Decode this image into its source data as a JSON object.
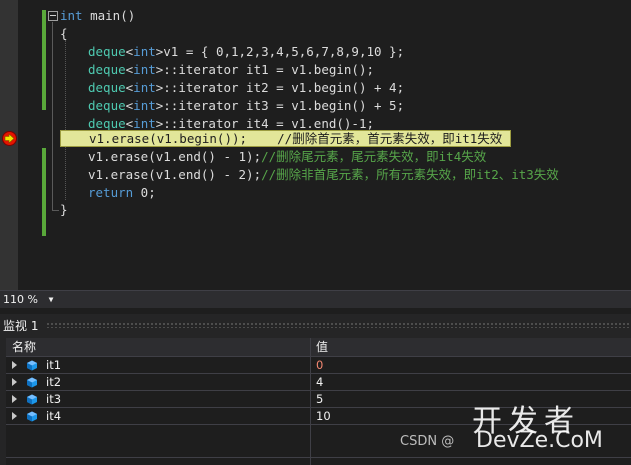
{
  "editor": {
    "lines": {
      "l1": {
        "kw": "int",
        "rest": " main()"
      },
      "l2": {
        "text": "{"
      },
      "l3": {
        "t1": "deque",
        "t2": "<",
        "t3": "int",
        "t4": ">v1 = { 0,1,2,3,4,5,6,7,8,9,10 };"
      },
      "l4": {
        "t1": "deque",
        "t2": "<",
        "t3": "int",
        "t4": ">::iterator it1 = v1.begin();"
      },
      "l5": {
        "t1": "deque",
        "t2": "<",
        "t3": "int",
        "t4": ">::iterator it2 = v1.begin() + 4;"
      },
      "l6": {
        "t1": "deque",
        "t2": "<",
        "t3": "int",
        "t4": ">::iterator it3 = v1.begin() + 5;"
      },
      "l7": {
        "t1": "deque",
        "t2": "<",
        "t3": "int",
        "t4": ">::iterator it4 = v1.end()-1;"
      },
      "l8": {
        "code": "v1.erase(v1.begin());",
        "comment": "    //删除首元素，首元素失效，即it1失效"
      },
      "l9": {
        "code": "v1.erase(v1.end() - 1);",
        "comment": "//删除尾元素，尾元素失效，即it4失效"
      },
      "l10": {
        "code": "v1.erase(v1.end() - 2);",
        "comment": "//删除非首尾元素，所有元素失效，即it2、it3失效"
      },
      "l11": {
        "kw": "return",
        "rest": " 0;"
      },
      "l12": {
        "text": "}"
      }
    }
  },
  "zoom": {
    "label": "110 %"
  },
  "watch": {
    "title": "监视 1",
    "col_name": "名称",
    "col_value": "值",
    "rows": [
      {
        "name": "it1",
        "value": "0",
        "value_color": "#f48771"
      },
      {
        "name": "it2",
        "value": "4",
        "value_color": "#f1f1f1"
      },
      {
        "name": "it3",
        "value": "5",
        "value_color": "#f1f1f1"
      },
      {
        "name": "it4",
        "value": "10",
        "value_color": "#f1f1f1"
      }
    ]
  },
  "watermark": {
    "cn": "开发者",
    "csdn": "CSDN @",
    "dev": "DevZe.CoM"
  },
  "colors": {
    "keyword": "#569cd6",
    "type": "#4ec9b0",
    "comment": "#57a64a",
    "highlight": "#e2e699",
    "breakpoint": "#e51400"
  }
}
